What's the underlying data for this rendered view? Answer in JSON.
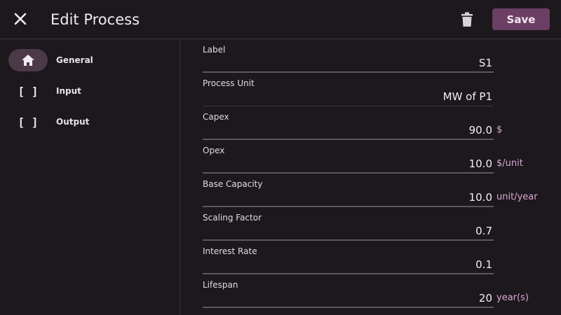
{
  "header": {
    "title": "Edit Process",
    "save_label": "Save",
    "close_icon": "close-icon",
    "trash_icon": "trash-icon"
  },
  "colors": {
    "accent": "#6a3f63",
    "unit_text": "#dca8d6",
    "background": "#1c181c"
  },
  "sidebar": {
    "items": [
      {
        "label": "General",
        "icon": "home-icon",
        "active": true
      },
      {
        "label": "Input",
        "icon": "brackets-icon",
        "active": false
      },
      {
        "label": "Output",
        "icon": "brackets-icon",
        "active": false
      }
    ]
  },
  "form": {
    "fields": [
      {
        "label": "Label",
        "value": "S1",
        "unit": ""
      },
      {
        "label": "Process Unit",
        "value": "MW of P1",
        "unit": ""
      },
      {
        "label": "Capex",
        "value": "90.0",
        "unit": "$"
      },
      {
        "label": "Opex",
        "value": "10.0",
        "unit": "$/unit"
      },
      {
        "label": "Base Capacity",
        "value": "10.0",
        "unit": "unit/year"
      },
      {
        "label": "Scaling Factor",
        "value": "0.7",
        "unit": ""
      },
      {
        "label": "Interest Rate",
        "value": "0.1",
        "unit": ""
      },
      {
        "label": "Lifespan",
        "value": "20",
        "unit": "year(s)"
      }
    ]
  }
}
